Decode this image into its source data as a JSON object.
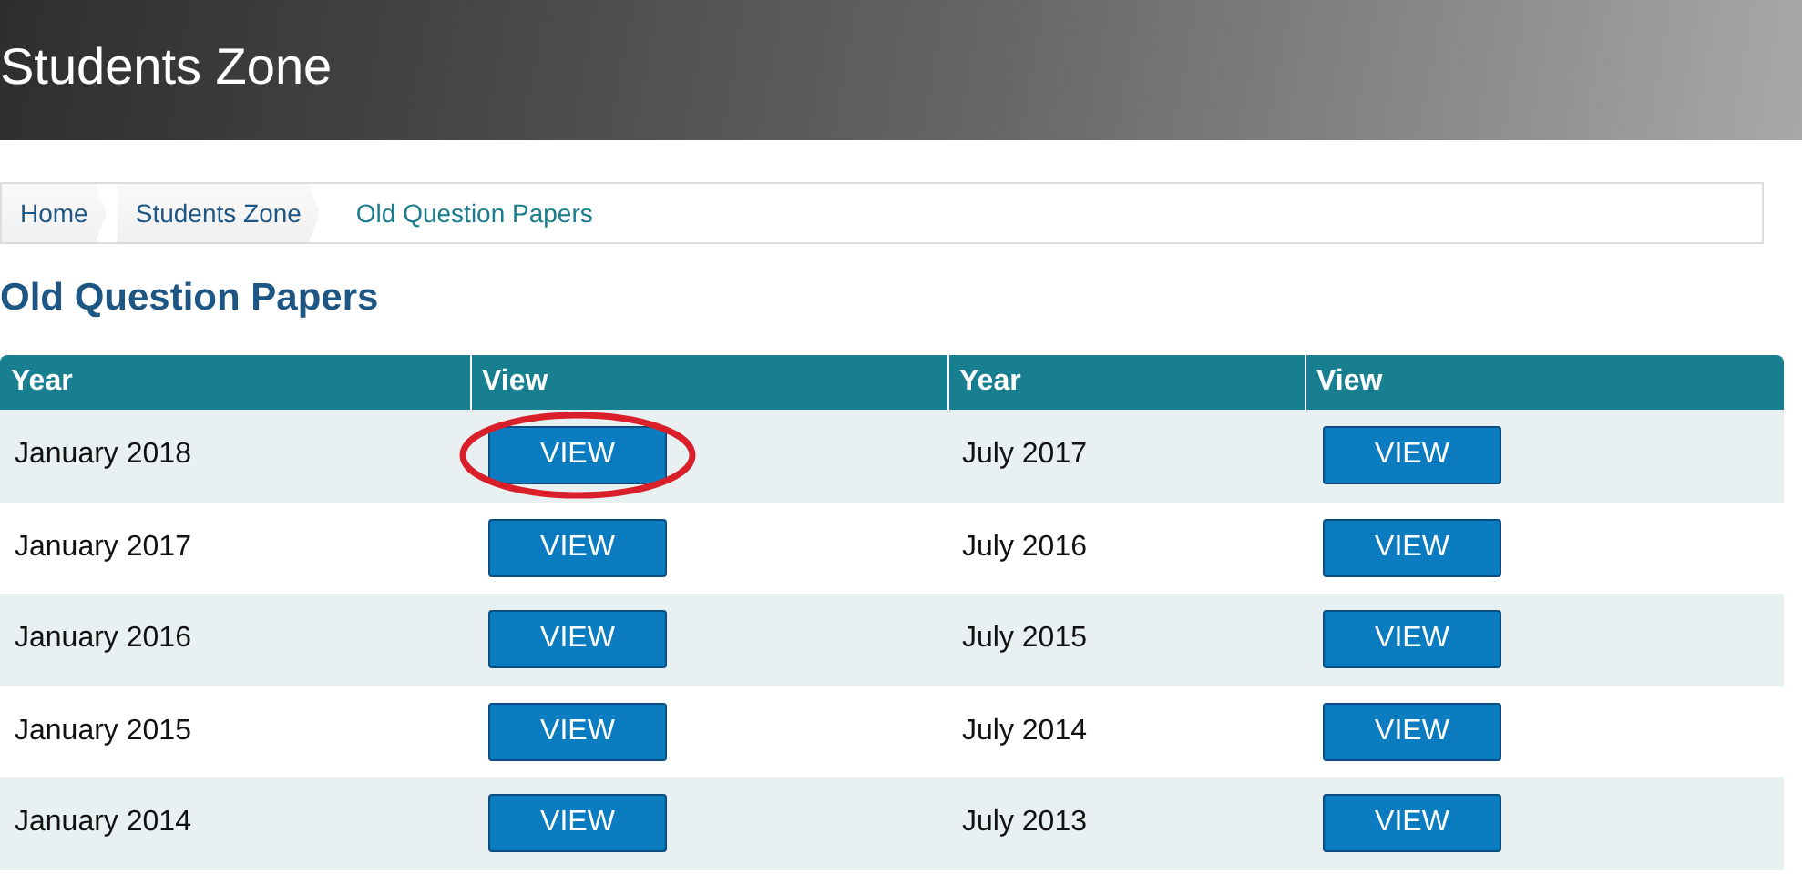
{
  "banner": {
    "title": "Students Zone"
  },
  "breadcrumb": [
    {
      "label": "Home",
      "current": false
    },
    {
      "label": "Students Zone",
      "current": false
    },
    {
      "label": "Old Question Papers",
      "current": true
    }
  ],
  "heading": "Old Question Papers",
  "table": {
    "columns": [
      "Year",
      "View",
      "Year",
      "View"
    ],
    "rows": [
      {
        "left": {
          "year": "January 2018",
          "button": "VIEW",
          "circled": true
        },
        "right": {
          "year": "July 2017",
          "button": "VIEW",
          "circled": false
        }
      },
      {
        "left": {
          "year": "January 2017",
          "button": "VIEW",
          "circled": false
        },
        "right": {
          "year": "July 2016",
          "button": "VIEW",
          "circled": false
        }
      },
      {
        "left": {
          "year": "January 2016",
          "button": "VIEW",
          "circled": false
        },
        "right": {
          "year": "July 2015",
          "button": "VIEW",
          "circled": false
        }
      },
      {
        "left": {
          "year": "January 2015",
          "button": "VIEW",
          "circled": false
        },
        "right": {
          "year": "July 2014",
          "button": "VIEW",
          "circled": false
        }
      },
      {
        "left": {
          "year": "January 2014",
          "button": "VIEW",
          "circled": false
        },
        "right": {
          "year": "July 2013",
          "button": "VIEW",
          "circled": false
        }
      }
    ]
  }
}
